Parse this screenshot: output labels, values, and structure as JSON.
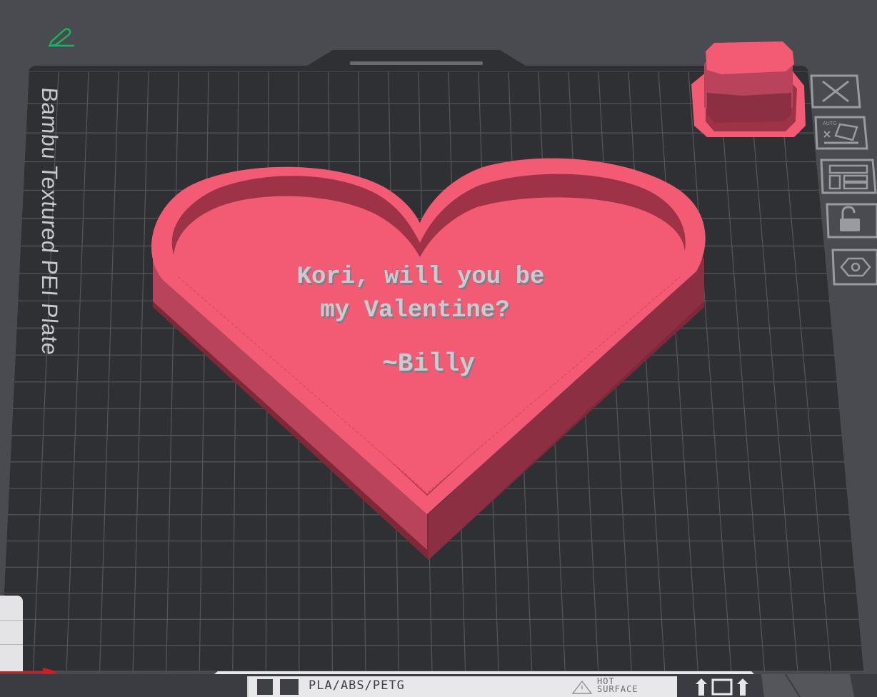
{
  "plate": {
    "label": "Bambu Textured PEI Plate",
    "material_label": "PLA/ABS/PETG",
    "warning_label": "HOT SURFACE",
    "warning_line1": "HOT",
    "warning_line2": "SURFACE"
  },
  "model": {
    "message_line1": "Kori, will you be",
    "message_line2": "my Valentine?",
    "signature": "~Billy",
    "color": "#f35a74"
  },
  "toolbar": {
    "icons": [
      "close-icon",
      "auto-orient-icon",
      "arrange-icon",
      "lock-icon",
      "hexagon-icon"
    ],
    "auto_label": "AUTO"
  },
  "colors": {
    "background": "#4a4b50",
    "plate": "#2f3034",
    "grid": "#5b5c62",
    "model": "#f35a74",
    "model_side": "#b8435a",
    "model_dark": "#7e2838",
    "pencil": "#18b35e",
    "axis": "#d11d22"
  }
}
